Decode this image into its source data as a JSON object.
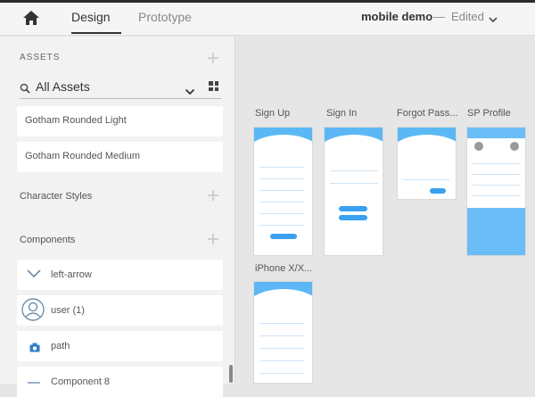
{
  "topbar": {
    "home_icon": "home-icon",
    "tabs": [
      {
        "label": "Design",
        "active": true
      },
      {
        "label": "Prototype",
        "active": false
      }
    ],
    "doc_title": "mobile demo",
    "doc_separator": "—",
    "doc_status": "Edited",
    "chevron_icon": "chevron-down-icon"
  },
  "sidebar": {
    "assets_heading": "ASSETS",
    "search_value": "All Assets",
    "grid_icon": "grid-view-icon",
    "fonts": [
      "Gotham Rounded Light",
      "Gotham Rounded Medium"
    ],
    "character_styles_label": "Character Styles",
    "components_label": "Components",
    "components": [
      {
        "label": "left-arrow",
        "icon": "left-arrow-icon"
      },
      {
        "label": "user (1)",
        "icon": "user-icon"
      },
      {
        "label": "path",
        "icon": "camera-icon"
      },
      {
        "label": "Component 8",
        "icon": "component-icon"
      }
    ]
  },
  "canvas": {
    "artboards": [
      "Sign Up",
      "Sign In",
      "Forgot Pass...",
      "SP Profile",
      "iPhone X/X..."
    ]
  },
  "colors": {
    "accent": "#5bb8f5",
    "sidebar_bg": "#f2f2f2",
    "canvas_bg": "#e6e6e6"
  }
}
